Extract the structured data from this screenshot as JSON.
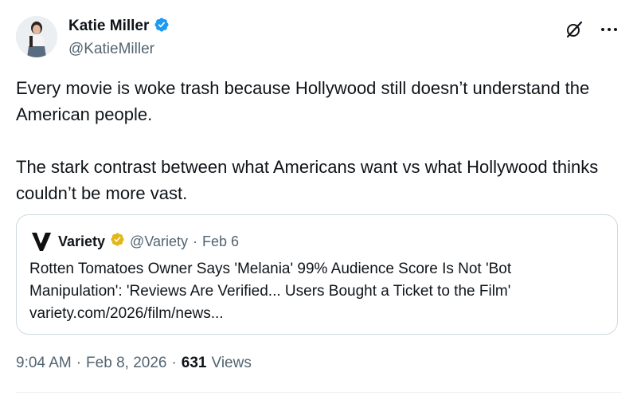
{
  "author": {
    "name": "Katie Miller",
    "handle": "@KatieMiller"
  },
  "tweet": {
    "paragraphs": [
      "Every movie is woke trash because Hollywood still doesn’t understand the American people.",
      "The stark contrast between what Americans want vs what Hollywood thinks couldn’t be more vast."
    ]
  },
  "quoted": {
    "name": "Variety",
    "handle": "@Variety",
    "separator": "·",
    "date": "Feb 6",
    "lines": [
      "Rotten Tomatoes Owner Says 'Melania' 99% Audience Score Is Not 'Bot",
      "Manipulation': 'Reviews Are Verified... Users Bought a Ticket to the Film'",
      "variety.com/2026/film/news..."
    ]
  },
  "meta": {
    "time": "9:04 AM",
    "sep1": "·",
    "date": "Feb 8, 2026",
    "sep2": "·",
    "views_count": "631",
    "views_label": "Views"
  },
  "colors": {
    "verified_blue": "#1d9bf0",
    "verified_gold": "#e2b719",
    "secondary_text": "#536471",
    "border": "#cfd9de"
  },
  "icons": {
    "top_left": "grok-icon",
    "top_right": "more-icon"
  }
}
